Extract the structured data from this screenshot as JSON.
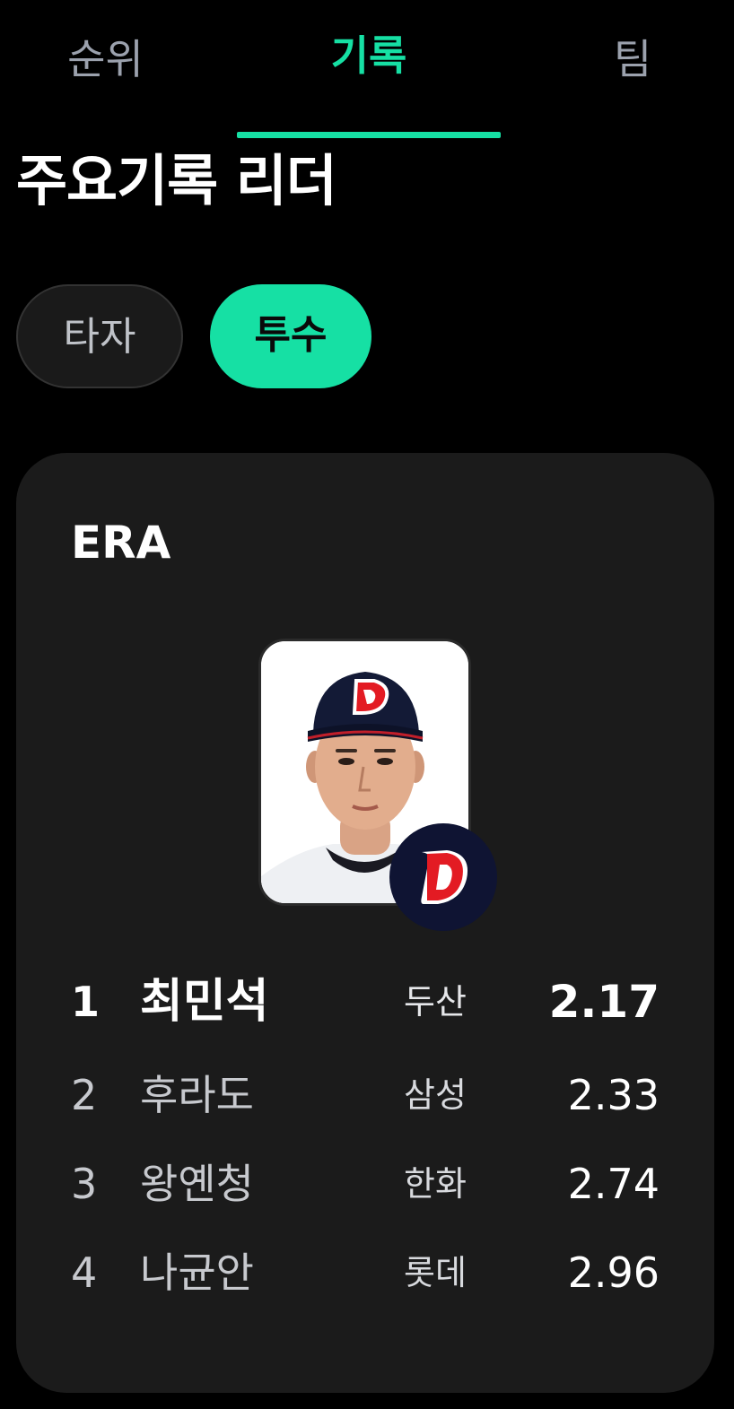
{
  "tabs": [
    {
      "label": "순위"
    },
    {
      "label": "기록"
    },
    {
      "label": "팀"
    }
  ],
  "active_tab": "기록",
  "section_title": "주요기록 리더",
  "segments": {
    "batter": "타자",
    "pitcher": "투수",
    "selected": "투수"
  },
  "card": {
    "title": "ERA",
    "leader_photo_icon": "player-photo",
    "leader_team_logo": "doosan-d-logo",
    "rows": [
      {
        "rank": "1",
        "name": "최민석",
        "team": "두산",
        "value": "2.17"
      },
      {
        "rank": "2",
        "name": "후라도",
        "team": "삼성",
        "value": "2.33"
      },
      {
        "rank": "3",
        "name": "왕옌청",
        "team": "한화",
        "value": "2.74"
      },
      {
        "rank": "4",
        "name": "나균안",
        "team": "롯데",
        "value": "2.96"
      }
    ]
  },
  "colors": {
    "accent": "#16e0a4",
    "background": "#000000",
    "card": "#1b1b1b",
    "team_badge": "#0f1433",
    "logo_red": "#e31b23"
  }
}
